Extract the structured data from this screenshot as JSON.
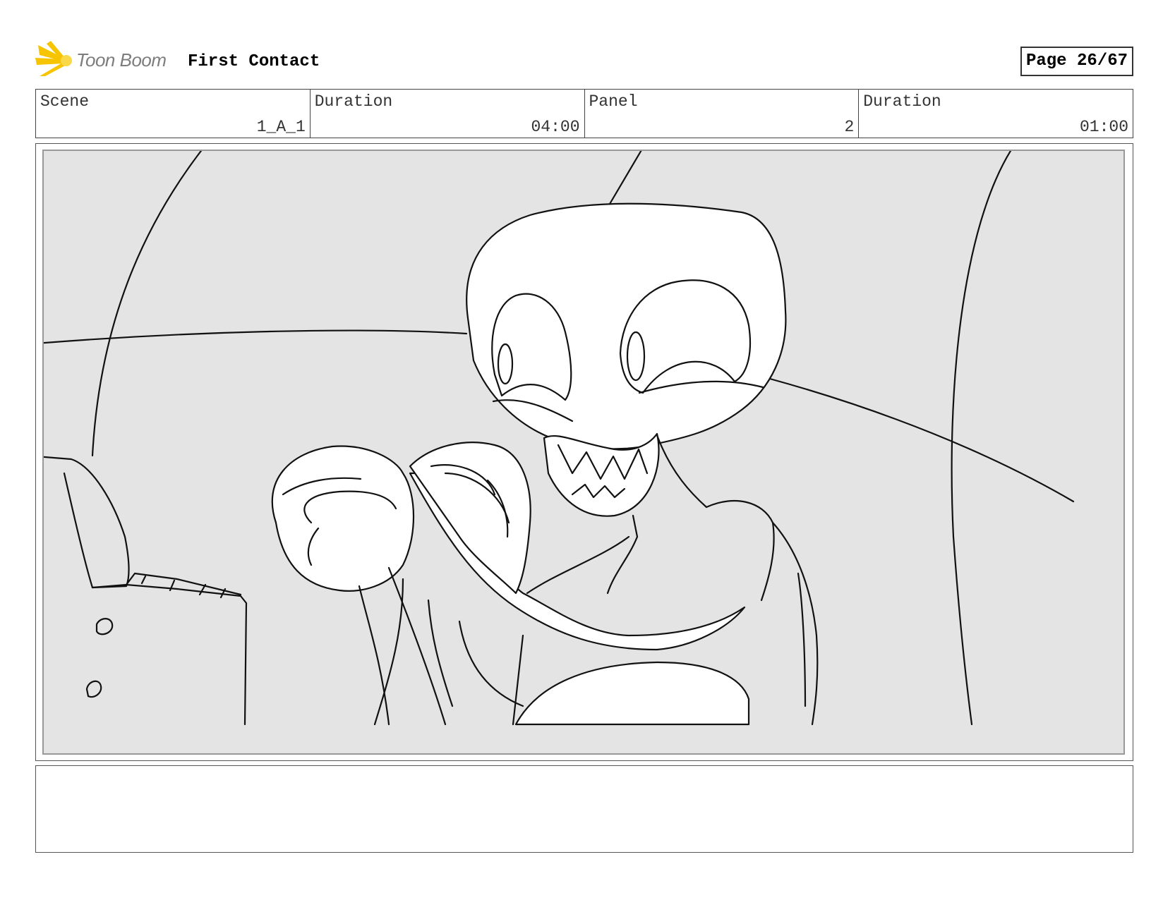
{
  "header": {
    "logo_text": "Toon Boom",
    "project_title": "First Contact",
    "page_label": "Page 26/67"
  },
  "info": [
    {
      "label": "Scene",
      "value": "1_A_1"
    },
    {
      "label": "Duration",
      "value": "04:00"
    },
    {
      "label": "Panel",
      "value": "2"
    },
    {
      "label": "Duration",
      "value": "01:00"
    }
  ],
  "panel": {
    "background_color": "#e4e4e4",
    "line_color": "#111111"
  },
  "notes": {
    "text": ""
  }
}
